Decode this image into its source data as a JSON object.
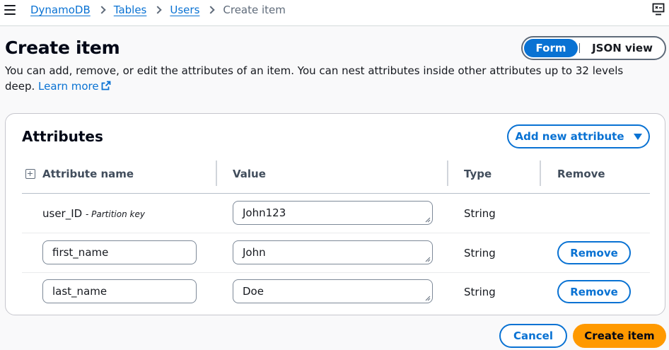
{
  "breadcrumbs": {
    "items": [
      "DynamoDB",
      "Tables",
      "Users"
    ],
    "current": "Create item"
  },
  "header": {
    "title": "Create item",
    "view_toggle": {
      "form": "Form",
      "json": "JSON view",
      "selected": "Form"
    }
  },
  "description": {
    "text": "You can add, remove, or edit the attributes of an item. You can nest attributes inside other attributes up to 32 levels deep. ",
    "learn_more": "Learn more"
  },
  "attributes": {
    "title": "Attributes",
    "add_button": "Add new attribute",
    "columns": {
      "name": "Attribute name",
      "value": "Value",
      "type": "Type",
      "remove": "Remove"
    },
    "rows": [
      {
        "name": "user_ID",
        "name_note": "- Partition key",
        "value": "John123",
        "type": "String"
      },
      {
        "name": "first_name",
        "value": "John",
        "type": "String",
        "remove": "Remove"
      },
      {
        "name": "last_name",
        "value": "Doe",
        "type": "String",
        "remove": "Remove"
      }
    ]
  },
  "footer": {
    "cancel": "Cancel",
    "create": "Create item"
  },
  "colors": {
    "link": "#0972d3",
    "primary": "#ff9900",
    "text": "#16191f",
    "border": "#7d8998"
  },
  "icons": {
    "menu": "hamburger-menu-icon",
    "tools": "tools-panel-icon",
    "external": "external-link-icon",
    "expand": "expand-all-icon",
    "caret": "caret-down-icon"
  }
}
